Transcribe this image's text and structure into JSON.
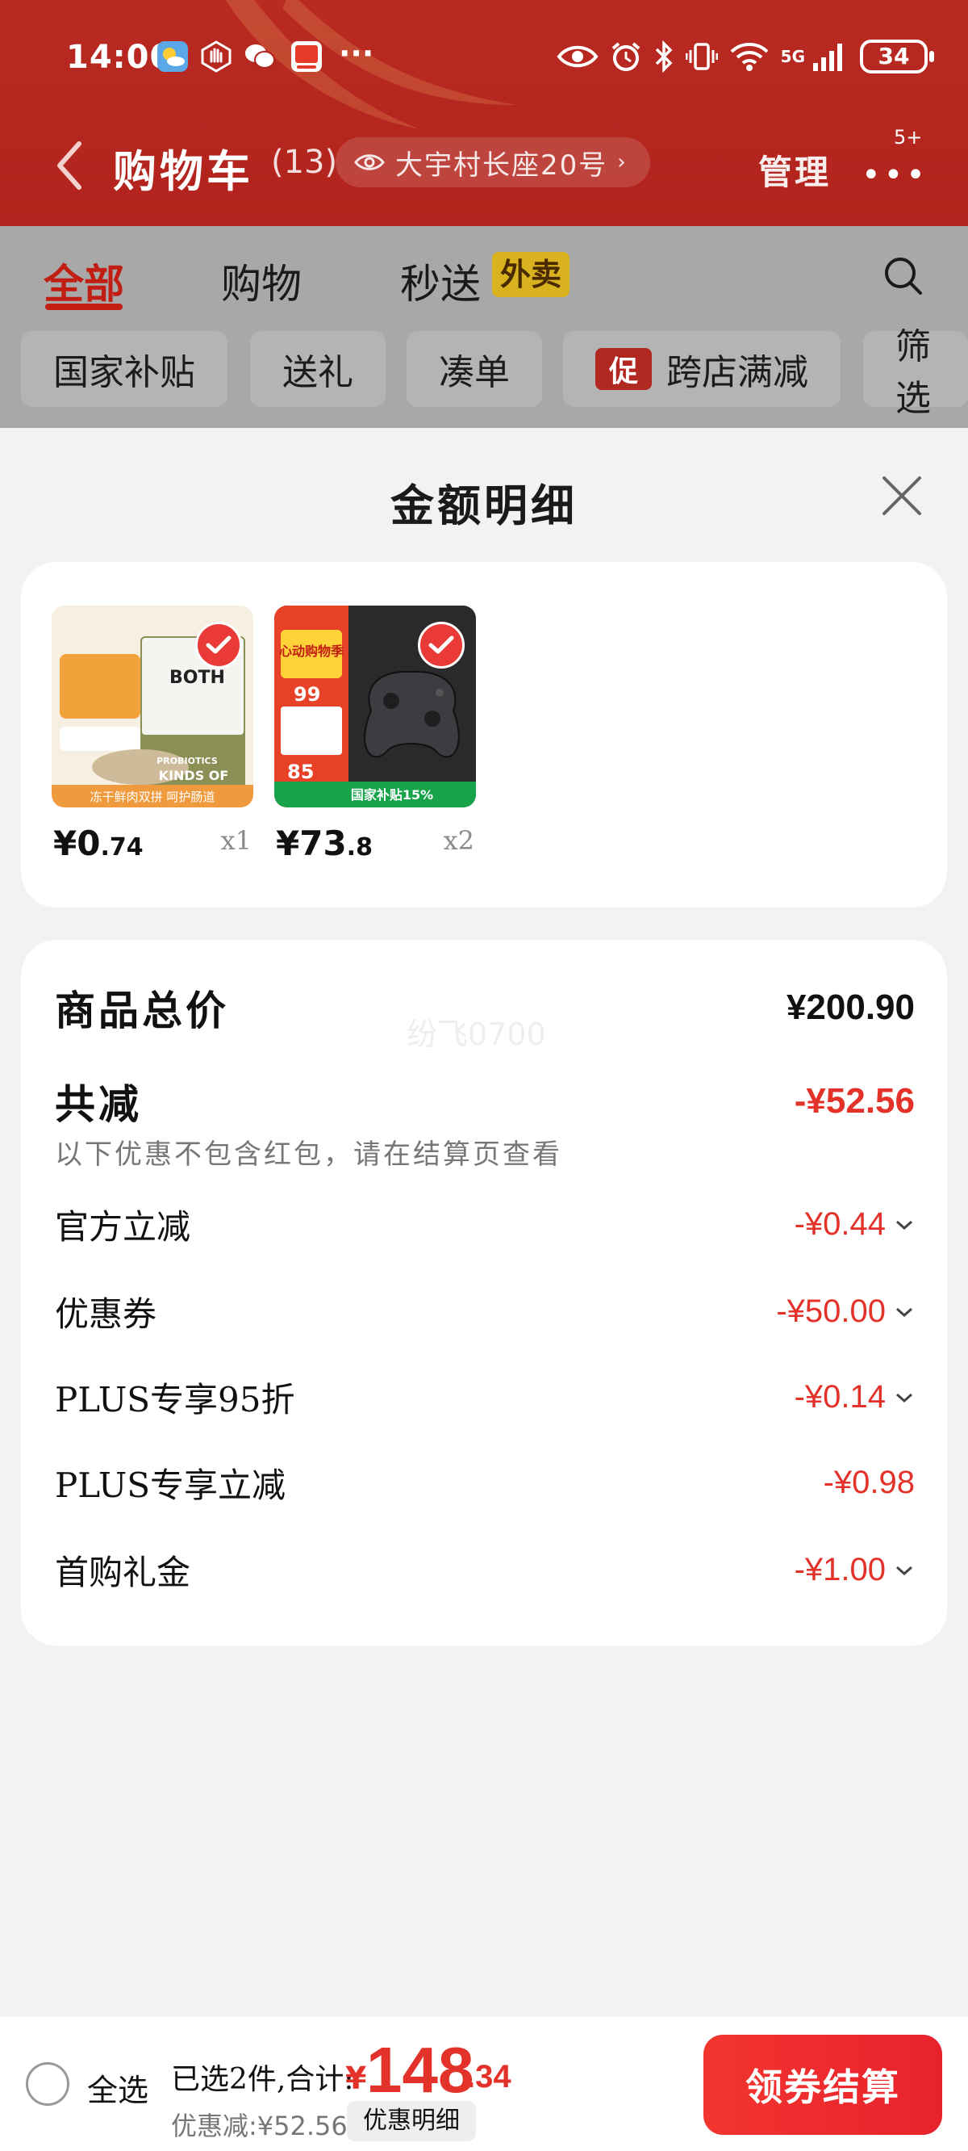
{
  "status_bar": {
    "time": "14:00",
    "left_icons": [
      "weather-icon",
      "hand-icon",
      "wechat-icon",
      "app-icon"
    ],
    "more": "···",
    "right_icons": [
      "eye-icon",
      "alarm-icon",
      "bluetooth-icon",
      "vibrate-icon",
      "wifi-icon",
      "signal-icon"
    ],
    "network": "5G",
    "battery": "34"
  },
  "header": {
    "title": "购物车",
    "count": "(13)",
    "address": "大宇村长座20号",
    "manage": "管理",
    "more_badge": "5+"
  },
  "tabs": {
    "items": [
      "全部",
      "购物",
      "秒送"
    ],
    "active": "全部",
    "takeaway_badge": "外卖"
  },
  "filters": [
    "国家补贴",
    "送礼",
    "凑单",
    "跨店满减",
    "筛选"
  ],
  "filter_promo_badge": "促",
  "sheet": {
    "title": "金额明细",
    "products": [
      {
        "name": "BOTH 冻干鲜肉双拼 猫粮",
        "thumb_text": {
          "brand": "BOTH",
          "line1": "PROBIOTICS",
          "line2": "KINDS OF",
          "caption": "冻干鲜肉双拼 呵护肠道"
        },
        "price_int": "¥0",
        "price_dec": ".74",
        "qty": "x1"
      },
      {
        "name": "游戏手柄",
        "thumb_text": {
          "badge": "心动购物季",
          "num1": "99",
          "num2": "85",
          "caption": "国家补贴15%"
        },
        "price_int": "¥73",
        "price_dec": ".8",
        "qty": "x2"
      }
    ],
    "summary": {
      "total_label": "商品总价",
      "total_value": "¥200.90",
      "watermark": "纷飞0700",
      "reduce_label": "共减",
      "reduce_value": "-¥52.56",
      "note": "以下优惠不包含红包，请在结算页查看",
      "items": [
        {
          "label": "官方立减",
          "value": "-¥0.44",
          "expandable": true
        },
        {
          "label": "优惠券",
          "value": "-¥50.00",
          "expandable": true
        },
        {
          "label": "PLUS专享95折",
          "value": "-¥0.14",
          "expandable": true
        },
        {
          "label": "PLUS专享立减",
          "value": "-¥0.98",
          "expandable": false
        },
        {
          "label": "首购礼金",
          "value": "-¥1.00",
          "expandable": true
        }
      ]
    }
  },
  "bottom_bar": {
    "select_all": "全选",
    "selected_text": "已选2件,合计:",
    "total_symbol": "¥",
    "total_int": "148",
    "total_dec": ".34",
    "saved_text": "优惠减:¥52.56",
    "detail_button": "优惠明细",
    "checkout_button": "领券结算"
  },
  "colors": {
    "header_red": "#b1231c",
    "accent_red": "#e2322a",
    "tab_active": "#c21d12",
    "checkout_red": "#f2352f"
  }
}
